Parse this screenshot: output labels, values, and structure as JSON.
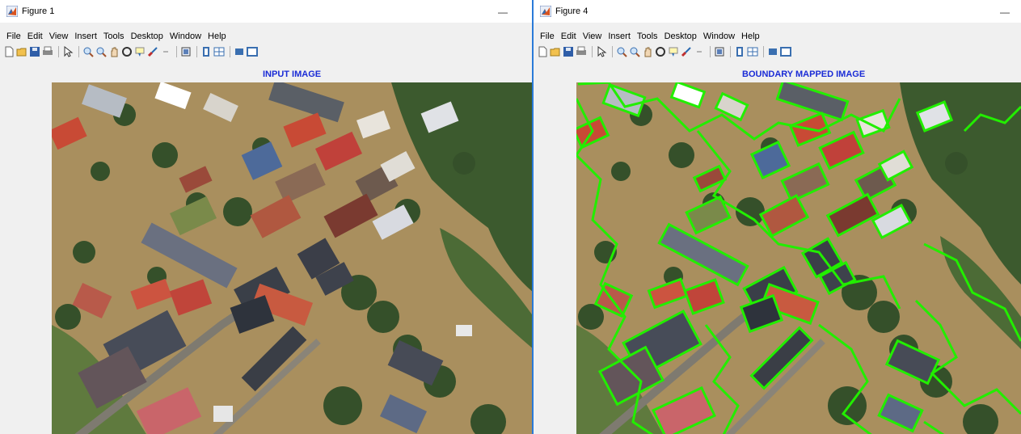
{
  "windows": [
    {
      "title": "Figure 1",
      "menus": [
        "File",
        "Edit",
        "View",
        "Insert",
        "Tools",
        "Desktop",
        "Window",
        "Help"
      ],
      "axes_title": "INPUT IMAGE",
      "image": "aerial photo of flooded town with houses and trees"
    },
    {
      "title": "Figure 4",
      "menus": [
        "File",
        "Edit",
        "View",
        "Insert",
        "Tools",
        "Desktop",
        "Window",
        "Help"
      ],
      "axes_title": "BOUNDARY MAPPED IMAGE",
      "image": "aerial photo of flooded town with green boundary outlines around buildings and trees"
    }
  ],
  "colors": {
    "title_blue": "#1a2bd6",
    "flood_water": "#a98f5e",
    "boundary": "#22ee00",
    "window_border": "#2a7ad8"
  },
  "icons": {
    "window_logo": "matlab-logo-icon",
    "minimize": "minimize-icon",
    "toolbar": [
      "new-figure-icon",
      "open-file-icon",
      "save-icon",
      "print-icon",
      "edit-plot-arrow-icon",
      "zoom-in-icon",
      "zoom-out-icon",
      "pan-icon",
      "rotate-3d-icon",
      "data-cursor-icon",
      "brush-icon",
      "link-plot-icon",
      "insert-colorbar-icon",
      "insert-legend-icon",
      "hide-plot-tools-icon",
      "show-plot-tools-icon"
    ]
  }
}
